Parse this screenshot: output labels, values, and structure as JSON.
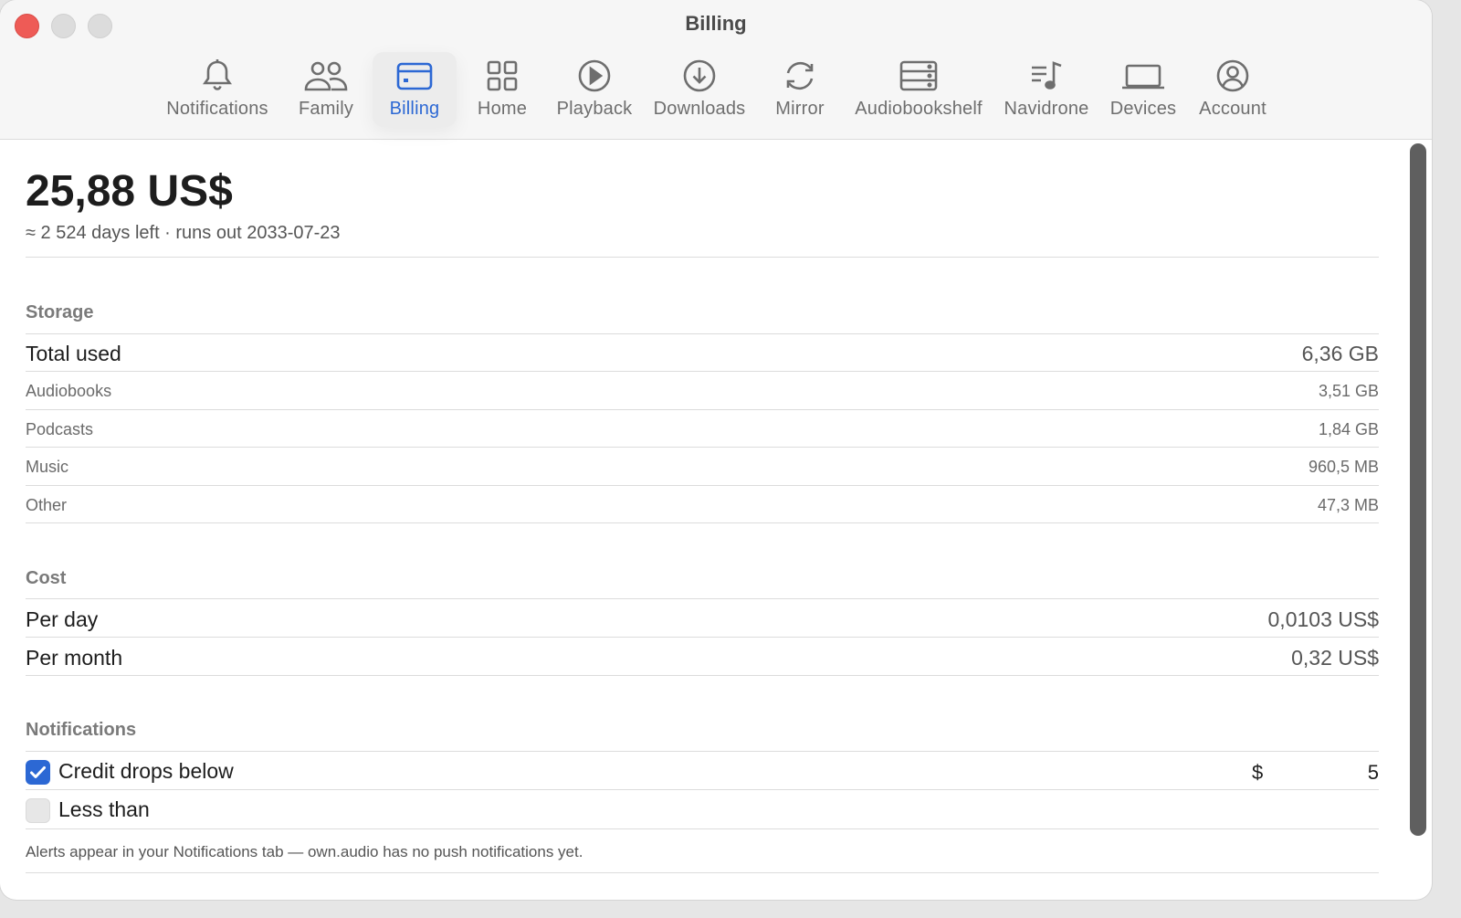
{
  "window": {
    "title": "Billing"
  },
  "toolbar": {
    "tabs": [
      {
        "label": "Notifications",
        "icon": "bell-icon"
      },
      {
        "label": "Family",
        "icon": "people-icon"
      },
      {
        "label": "Billing",
        "icon": "credit-card-icon",
        "active": true
      },
      {
        "label": "Home",
        "icon": "grid-icon"
      },
      {
        "label": "Playback",
        "icon": "play-circle-icon"
      },
      {
        "label": "Downloads",
        "icon": "download-circle-icon"
      },
      {
        "label": "Mirror",
        "icon": "sync-icon"
      },
      {
        "label": "Audiobookshelf",
        "icon": "server-icon"
      },
      {
        "label": "Navidrone",
        "icon": "music-list-icon"
      },
      {
        "label": "Devices",
        "icon": "laptop-icon"
      },
      {
        "label": "Account",
        "icon": "user-circle-icon"
      }
    ]
  },
  "balance": {
    "amount": "25,88 US$",
    "subtitle": "≈ 2 524 days left · runs out 2033-07-23"
  },
  "storage": {
    "heading": "Storage",
    "total": {
      "label": "Total used",
      "value": "6,36 GB"
    },
    "items": [
      {
        "label": "Audiobooks",
        "value": "3,51 GB"
      },
      {
        "label": "Podcasts",
        "value": "1,84 GB"
      },
      {
        "label": "Music",
        "value": "960,5 MB"
      },
      {
        "label": "Other",
        "value": "47,3 MB"
      }
    ]
  },
  "cost": {
    "heading": "Cost",
    "per_day": {
      "label": "Per day",
      "value": "0,0103 US$"
    },
    "per_month": {
      "label": "Per month",
      "value": "0,32 US$"
    }
  },
  "notifications": {
    "heading": "Notifications",
    "credit": {
      "label": "Credit drops below",
      "checked": true,
      "currency": "$",
      "amount": "5"
    },
    "less": {
      "label": "Less than",
      "checked": false
    },
    "note": "Alerts appear in your Notifications tab — own.audio has no push notifications yet."
  },
  "colors": {
    "accent": "#2c68d4",
    "close": "#ee5b56"
  }
}
